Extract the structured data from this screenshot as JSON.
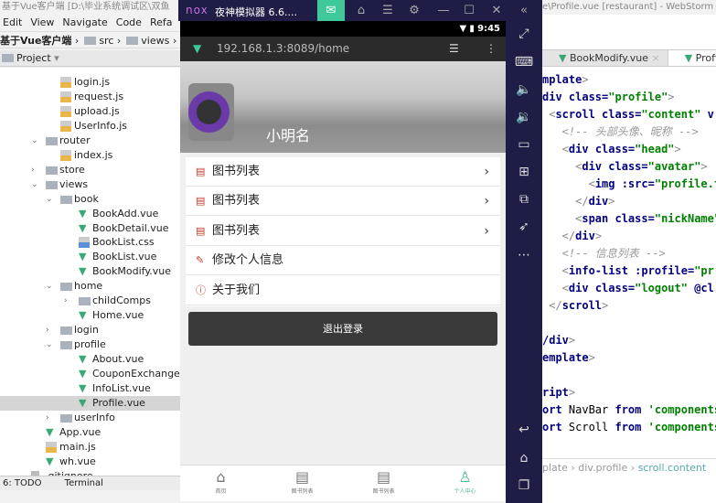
{
  "ide": {
    "title": "基于Vue客户端 [D:\\毕业系统调试区\\双鱼",
    "menu": [
      "Edit",
      "View",
      "Navigate",
      "Code",
      "Refa"
    ],
    "breadcrumb": {
      "root": "基于Vue客户端",
      "items": [
        "src",
        "views"
      ]
    },
    "project_label": "Project",
    "tree": [
      {
        "label": "login.js",
        "type": "js",
        "depth": 4
      },
      {
        "label": "request.js",
        "type": "js",
        "depth": 4
      },
      {
        "label": "upload.js",
        "type": "js",
        "depth": 4
      },
      {
        "label": "UserInfo.js",
        "type": "js",
        "depth": 4
      },
      {
        "label": "router",
        "type": "folder",
        "depth": 3,
        "expanded": true
      },
      {
        "label": "index.js",
        "type": "js",
        "depth": 4
      },
      {
        "label": "store",
        "type": "folder",
        "depth": 3,
        "expanded": false
      },
      {
        "label": "views",
        "type": "folder",
        "depth": 3,
        "expanded": true
      },
      {
        "label": "book",
        "type": "folder",
        "depth": 4,
        "expanded": true
      },
      {
        "label": "BookAdd.vue",
        "type": "vue",
        "depth": 5
      },
      {
        "label": "BookDetail.vue",
        "type": "vue",
        "depth": 5
      },
      {
        "label": "BookList.css",
        "type": "css",
        "depth": 5
      },
      {
        "label": "BookList.vue",
        "type": "vue",
        "depth": 5
      },
      {
        "label": "BookModify.vue",
        "type": "vue",
        "depth": 5
      },
      {
        "label": "home",
        "type": "folder",
        "depth": 4,
        "expanded": true
      },
      {
        "label": "childComps",
        "type": "folder",
        "depth": 5,
        "expanded": false
      },
      {
        "label": "Home.vue",
        "type": "vue",
        "depth": 5
      },
      {
        "label": "login",
        "type": "folder",
        "depth": 4,
        "expanded": false
      },
      {
        "label": "profile",
        "type": "folder",
        "depth": 4,
        "expanded": true
      },
      {
        "label": "About.vue",
        "type": "vue",
        "depth": 5
      },
      {
        "label": "CouponExchange.vue",
        "type": "vue",
        "depth": 5
      },
      {
        "label": "InfoList.vue",
        "type": "vue",
        "depth": 5
      },
      {
        "label": "Profile.vue",
        "type": "vue",
        "depth": 5,
        "selected": true
      },
      {
        "label": "userInfo",
        "type": "folder",
        "depth": 4,
        "expanded": false
      },
      {
        "label": "App.vue",
        "type": "vue",
        "depth": 3
      },
      {
        "label": "main.js",
        "type": "js",
        "depth": 3
      },
      {
        "label": "wh.vue",
        "type": "vue",
        "depth": 3
      },
      {
        "label": ".gitignore",
        "type": "file",
        "depth": 2
      }
    ],
    "bottom_tabs": [
      "6: TODO",
      "Terminal"
    ]
  },
  "emulator": {
    "logo": "nox",
    "title": "夜神模拟器 6.6....",
    "status_time": "9:45",
    "url": "192.168.1.3:8089/home",
    "accent": "#3ec99a"
  },
  "app": {
    "nickname": "小明名",
    "list": [
      {
        "label": "图书列表",
        "icon": "book-icon",
        "chevron": true
      },
      {
        "label": "图书列表",
        "icon": "book-icon",
        "chevron": true
      },
      {
        "label": "图书列表",
        "icon": "book-icon",
        "chevron": true
      },
      {
        "label": "修改个人信息",
        "icon": "pencil-icon",
        "chevron": false
      },
      {
        "label": "关于我们",
        "icon": "info-icon",
        "chevron": false
      }
    ],
    "logout": "退出登录",
    "tabs": [
      {
        "label": "首页",
        "icon": "home-icon",
        "active": false
      },
      {
        "label": "图书列表",
        "icon": "document-icon",
        "active": false
      },
      {
        "label": "图书列表",
        "icon": "document-icon",
        "active": false
      },
      {
        "label": "个人中心",
        "icon": "person-icon",
        "active": true
      }
    ],
    "active_color": "#4cb88a"
  },
  "editor": {
    "title": "e\\Profile.vue [restaurant] - WebStorm",
    "tabs": [
      "BookModify.vue",
      "Profile"
    ],
    "lines": [
      [
        {
          "c": "tag",
          "t": "mplate"
        },
        {
          "c": "p",
          "t": ">"
        }
      ],
      [
        {
          "c": "tag",
          "t": "div "
        },
        {
          "c": "attr",
          "t": "class="
        },
        {
          "c": "str",
          "t": "\"profile\""
        },
        {
          "c": "p",
          "t": ">"
        }
      ],
      [
        {
          "c": "p",
          "t": " <"
        },
        {
          "c": "tag",
          "t": "scroll "
        },
        {
          "c": "attr",
          "t": "class="
        },
        {
          "c": "str",
          "t": "\"content\""
        },
        {
          "c": "tag",
          "t": " v"
        }
      ],
      [
        {
          "c": "cm",
          "t": "   <!-- 头部头像、昵称 -->"
        }
      ],
      [
        {
          "c": "p",
          "t": "   <"
        },
        {
          "c": "tag",
          "t": "div "
        },
        {
          "c": "attr",
          "t": "class="
        },
        {
          "c": "str",
          "t": "\"head\""
        },
        {
          "c": "p",
          "t": ">"
        }
      ],
      [
        {
          "c": "p",
          "t": "     <"
        },
        {
          "c": "tag",
          "t": "div "
        },
        {
          "c": "attr",
          "t": "class="
        },
        {
          "c": "str",
          "t": "\"avatar\""
        },
        {
          "c": "p",
          "t": ">"
        }
      ],
      [
        {
          "c": "p",
          "t": "       <"
        },
        {
          "c": "tag",
          "t": "img "
        },
        {
          "c": "attr",
          "t": ":src="
        },
        {
          "c": "str",
          "t": "\"profile.t"
        }
      ],
      [
        {
          "c": "p",
          "t": "     </"
        },
        {
          "c": "tag",
          "t": "div"
        },
        {
          "c": "p",
          "t": ">"
        }
      ],
      [
        {
          "c": "p",
          "t": "     <"
        },
        {
          "c": "tag",
          "t": "span "
        },
        {
          "c": "attr",
          "t": "class="
        },
        {
          "c": "str",
          "t": "\"nickName\""
        }
      ],
      [
        {
          "c": "p",
          "t": "   </"
        },
        {
          "c": "tag",
          "t": "div"
        },
        {
          "c": "p",
          "t": ">"
        }
      ],
      [
        {
          "c": "cm",
          "t": "   <!-- 信息列表 -->"
        }
      ],
      [
        {
          "c": "p",
          "t": "   <"
        },
        {
          "c": "tag",
          "t": "info-list "
        },
        {
          "c": "attr",
          "t": ":profile="
        },
        {
          "c": "str",
          "t": "\"pr"
        }
      ],
      [
        {
          "c": "p",
          "t": "   <"
        },
        {
          "c": "tag",
          "t": "div "
        },
        {
          "c": "attr",
          "t": "class="
        },
        {
          "c": "str",
          "t": "\"logout\""
        },
        {
          "c": "attr",
          "t": " @cl"
        }
      ],
      [
        {
          "c": "p",
          "t": " </"
        },
        {
          "c": "tag",
          "t": "scroll"
        },
        {
          "c": "p",
          "t": ">"
        }
      ],
      [],
      [
        {
          "c": "tag",
          "t": "/div"
        },
        {
          "c": "p",
          "t": ">"
        }
      ],
      [
        {
          "c": "tag",
          "t": "emplate"
        },
        {
          "c": "p",
          "t": ">"
        }
      ],
      [],
      [
        {
          "c": "tag",
          "t": "ript"
        },
        {
          "c": "p",
          "t": ">"
        }
      ],
      [
        {
          "c": "kw",
          "t": "ort "
        },
        {
          "c": "pl",
          "t": "NavBar "
        },
        {
          "c": "kw",
          "t": "from "
        },
        {
          "c": "str",
          "t": "'components"
        }
      ],
      [
        {
          "c": "kw",
          "t": "ort "
        },
        {
          "c": "pl",
          "t": "Scroll "
        },
        {
          "c": "kw",
          "t": "from "
        },
        {
          "c": "str",
          "t": "'components"
        }
      ]
    ],
    "breadcrumb": [
      "plate",
      "div.profile",
      "scroll.content"
    ]
  }
}
